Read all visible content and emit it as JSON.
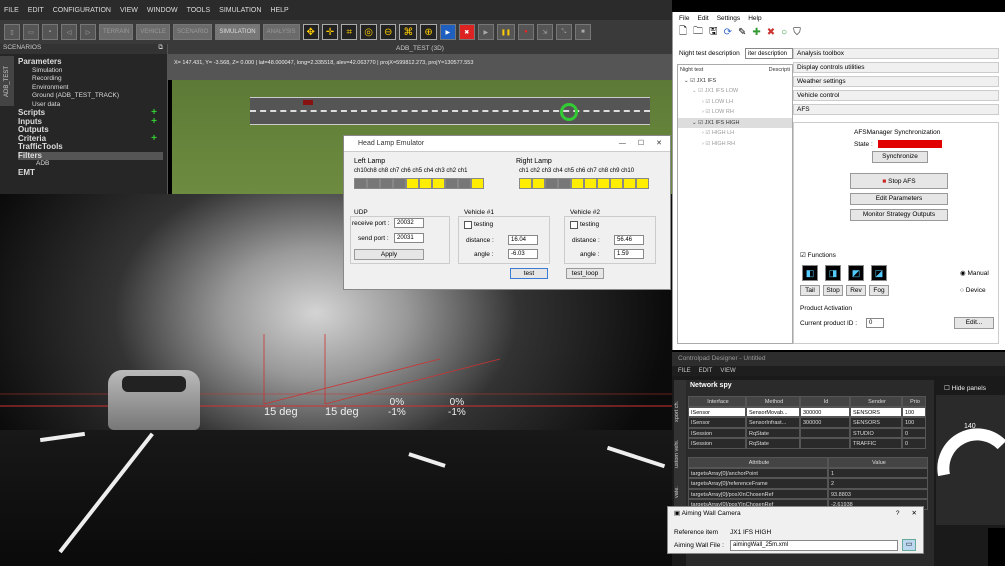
{
  "main_app": {
    "menu": [
      "FILE",
      "EDIT",
      "CONFIGURATION",
      "VIEW",
      "WINDOW",
      "TOOLS",
      "SIMULATION",
      "HELP"
    ],
    "mode_tabs": [
      "TERRAIN",
      "VEHICLE",
      "SCENARIO",
      "SIMULATION",
      "ANALYSIS"
    ],
    "scenarios_title": "SCENARIOS",
    "side_tab": "ADB_TEST",
    "tree": {
      "parameters": "Parameters",
      "simulation": "Simulation",
      "recording": "Recording",
      "environment": "Environment",
      "ground": "Ground (ADB_TEST_TRACK)",
      "user_data": "User data",
      "scripts": "Scripts",
      "inputs": "Inputs",
      "outputs": "Outputs",
      "criteria": "Criteria",
      "traffic_tools": "TrafficTools",
      "filters": "Filters",
      "adb": "ADB",
      "emt": "EMT"
    },
    "view_title": "ADB_TEST (3D)",
    "coords": "X= 147.431, Y= -3.568, Z= 0.000 | lat=48.000047, long=2.335518, alev=42.063770 | projX=599812.273, projY=130577.553",
    "angles": [
      "15 deg",
      "15 deg"
    ],
    "percents": [
      "0%\n-1%",
      "0%\n-1%"
    ]
  },
  "head_lamp": {
    "title": "Head Lamp Emulator",
    "left_lamp": "Left Lamp",
    "right_lamp": "Right Lamp",
    "left_channels": "ch10ch8 ch8 ch7 ch6 ch5 ch4 ch3 ch2 ch1",
    "right_channels": "ch1 ch2 ch3 ch4 ch5 ch6 ch7 ch8 ch9 ch10",
    "udp": "UDP",
    "receive_port_label": "receive port :",
    "receive_port": "20032",
    "send_port_label": "send port :",
    "send_port": "20031",
    "apply": "Apply",
    "vehicle1": "Vehicle #1",
    "vehicle2": "Vehicle #2",
    "testing": "testing",
    "distance_label": "distance :",
    "angle_label": "angle :",
    "v1_distance": "16.04",
    "v1_angle": "-6.03",
    "v2_distance": "56.46",
    "v2_angle": "1.59",
    "test": "test",
    "test_loop": "test_loop"
  },
  "afs_app": {
    "menu": [
      "File",
      "Edit",
      "Settings",
      "Help"
    ],
    "night_test_label": "Night test description",
    "night_test_value": "iter description",
    "tree_header_col1": "Night test",
    "tree_header_col2": "Descripti",
    "tree_items": [
      "JX1 IFS",
      "JX1 IFS LOW",
      "LOW LH",
      "LOW RH",
      "JX1 IFS HIGH",
      "HIGH LH",
      "HIGH RH"
    ],
    "tabs": [
      "Analysis toolbox",
      "Display controls utilities",
      "Weather settings",
      "Vehicle control",
      "AFS"
    ],
    "sync_title": "AFSManager Synchronization",
    "state_label": "State :",
    "state_color": "#e00000",
    "synchronize": "Synchronize",
    "stop_afs": "Stop AFS",
    "edit_parameters": "Edit Parameters",
    "monitor": "Monitor Strategy Outputs",
    "functions": "Functions",
    "func_labels": [
      "Tail",
      "Stop",
      "Rev",
      "Fog"
    ],
    "manual": "Manual",
    "device": "Device",
    "product_activation": "Product Activation",
    "current_product_label": "Current product ID :",
    "current_product": "0",
    "edit_btn": "Edit..."
  },
  "controlpad": {
    "title": "Controlpad Designer - Untitled",
    "menu": [
      "FILE",
      "EDIT",
      "VIEW"
    ],
    "netspy_title": "Network spy",
    "hide_panels": "Hide panels",
    "side_tabs": [
      "xport ch.",
      "ustom vehi.",
      "vate."
    ],
    "net_headers": [
      "Interface",
      "Method",
      "Id",
      "Sender",
      "Prio"
    ],
    "net_rows": [
      [
        "ISensor",
        "SensorMovab...",
        "300000",
        "SENSORS",
        "100"
      ],
      [
        "ISensor",
        "SensorInfrast...",
        "300000",
        "SENSORS",
        "100"
      ],
      [
        "ISession",
        "RqState",
        "",
        "STUDIO",
        "0"
      ],
      [
        "ISession",
        "RqState",
        "",
        "TRAFFIC",
        "0"
      ]
    ],
    "attr_headers": [
      "Attribute",
      "Value"
    ],
    "attr_rows": [
      [
        "targetsArray[0]/anchorPoint",
        "1"
      ],
      [
        "targetsArray[0]/referenceFrame",
        "2"
      ],
      [
        "targetsArray[0]/posXInChosenRef",
        "93.8803"
      ],
      [
        "targetsArray[0]/posYInChosenRef",
        "-2.61938"
      ]
    ],
    "gauge_value": "140"
  },
  "aiming": {
    "title": "Aiming Wall Camera",
    "reference_label": "Reference item",
    "reference_value": "JX1 IFS HIGH",
    "file_label": "Aiming Wall File :",
    "file_value": "aimingWall_25m.xml"
  }
}
